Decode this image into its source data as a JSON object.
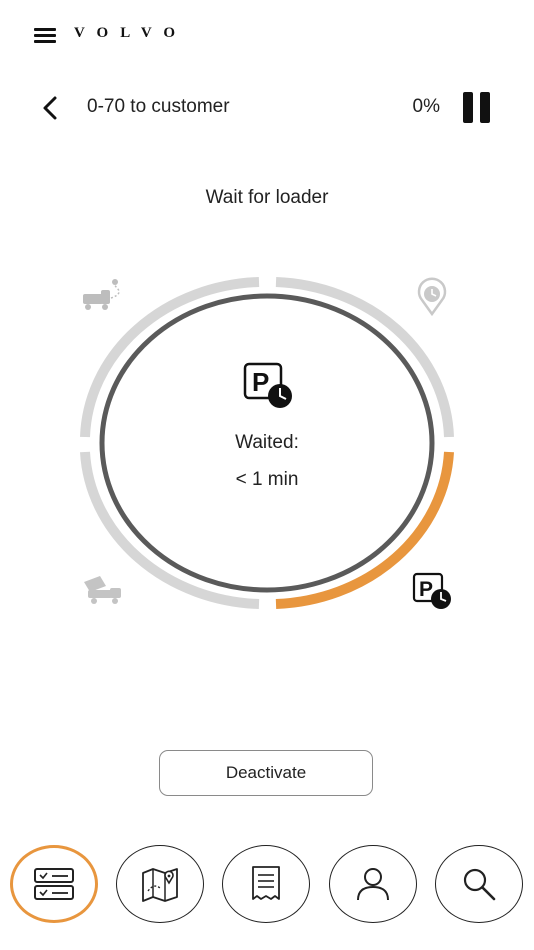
{
  "brand": "VOLVO",
  "route": {
    "title": "0-70 to customer",
    "progress": "0%"
  },
  "step": {
    "title": "Wait for loader",
    "waited_label": "Waited:",
    "waited_value": "< 1 min"
  },
  "actions": {
    "deactivate": "Deactivate"
  },
  "colors": {
    "accent": "#e8963e",
    "track": "#d6d6d6",
    "ring": "#5a5a5a"
  },
  "nav": [
    {
      "name": "checklist-icon",
      "active": true
    },
    {
      "name": "map-icon",
      "active": false
    },
    {
      "name": "receipt-icon",
      "active": false
    },
    {
      "name": "person-icon",
      "active": false
    },
    {
      "name": "search-icon",
      "active": false
    }
  ]
}
